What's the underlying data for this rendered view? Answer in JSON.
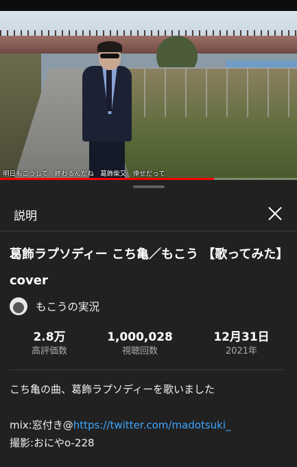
{
  "video": {
    "subtitle": "明日もこうして　終わるんだね　葛飾柴又　倖せだって",
    "progress": 0.72
  },
  "sheet": {
    "title": "説明",
    "close_icon": "close-icon"
  },
  "details": {
    "title": "葛飾ラプソディー こち亀／もこう 【歌ってみた】 cover",
    "channel": "もこうの実況"
  },
  "stats": [
    {
      "value": "2.8万",
      "label": "高評価数"
    },
    {
      "value": "1,000,028",
      "label": "視聴回数"
    },
    {
      "value": "12月31日",
      "label": "2021年"
    }
  ],
  "description": {
    "line1": "こち亀の曲、葛飾ラプソディーを歌いました",
    "mix_prefix": "mix:窓付き@",
    "mix_link": "https://twitter.com/madotsuki_",
    "photo": "撮影:おにやo-228"
  },
  "colors": {
    "background": "#212121",
    "link": "#3ea6ff",
    "progress": "#ff0000"
  }
}
